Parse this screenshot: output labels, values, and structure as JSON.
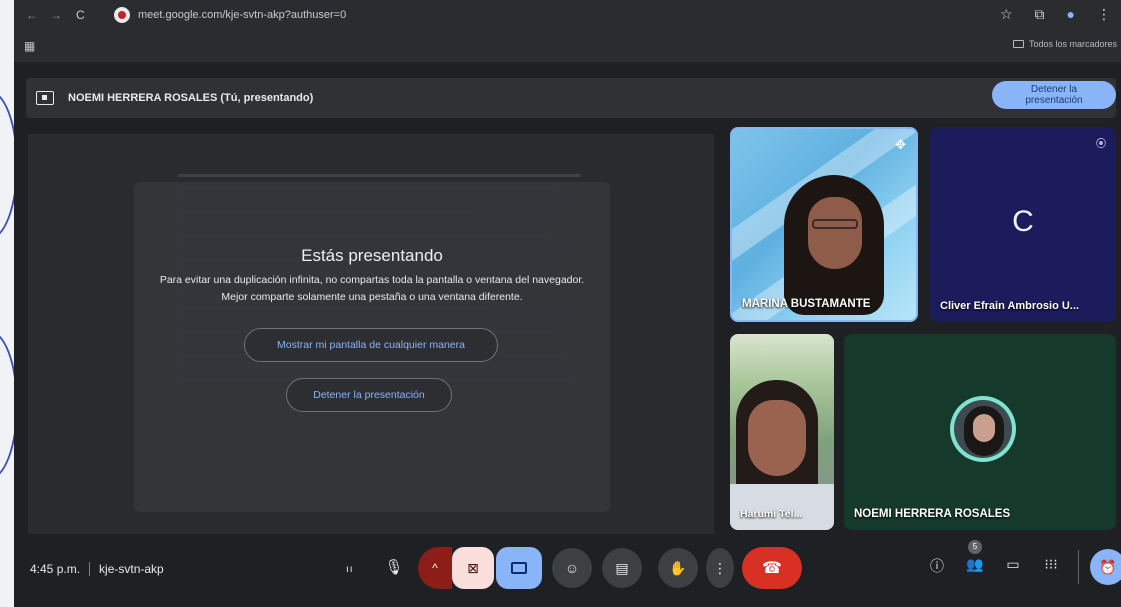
{
  "browser": {
    "url": "meet.google.com/kje-svtn-akp?authuser=0",
    "bookmarks_all_label": "Todos los marcadores"
  },
  "presenting_bar": {
    "title": "NOEMI HERRERA ROSALES (Tú, presentando)",
    "stop_button": "Detener la presentación"
  },
  "dialog": {
    "title": "Estás presentando",
    "body": "Para evitar una duplicación infinita, no compartas toda la pantalla o ventana del navegador. Mejor comparte solamente una pestaña o una ventana diferente.",
    "show_anyway_button": "Mostrar mi pantalla de cualquier manera",
    "stop_button": "Detener la presentación"
  },
  "participants": [
    {
      "name": "MARINA BUSTAMANTE"
    },
    {
      "name": "Cliver Efrain Ambrosio U...",
      "initial": "C"
    },
    {
      "name": "Harumi Tel..."
    },
    {
      "name": "NOEMI HERRERA ROSALES"
    }
  ],
  "footer": {
    "time": "4:45 p.m.",
    "meeting_code": "kje-svtn-akp",
    "participant_count": "5"
  },
  "colors": {
    "accent": "#8ab4f8",
    "end_call": "#d93025",
    "background": "#202124"
  },
  "icons": [
    "back-icon",
    "forward-icon",
    "reload-icon",
    "star-icon",
    "extensions-icon",
    "profile-icon",
    "menu-icon",
    "apps-icon",
    "folder-icon",
    "present-icon",
    "pin-icon",
    "mic-icon",
    "camera-off-icon",
    "present-screen-icon",
    "emoji-icon",
    "captions-icon",
    "raise-hand-icon",
    "more-options-icon",
    "end-call-icon",
    "info-icon",
    "people-icon",
    "chat-icon",
    "activities-icon",
    "host-controls-icon"
  ]
}
